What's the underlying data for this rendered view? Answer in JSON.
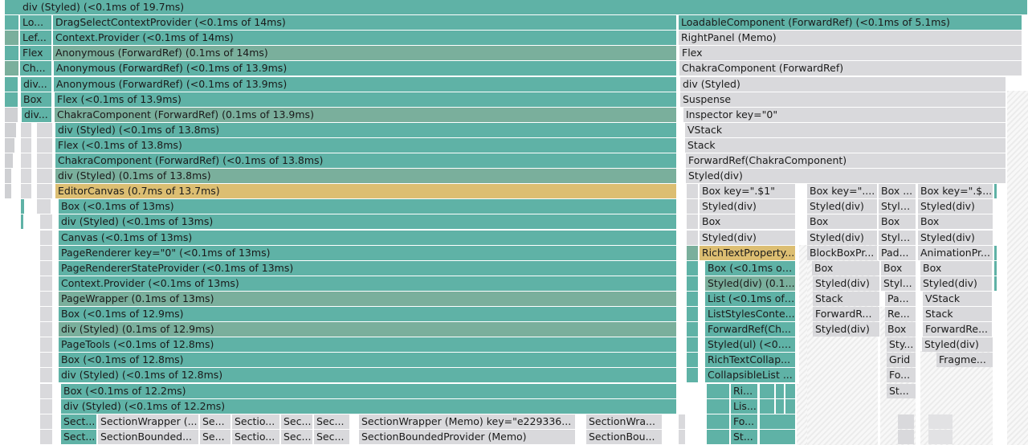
{
  "flamegraph": {
    "nodes": [
      {
        "label": "div (Styled) (<0.1ms of 19.7ms)",
        "c": "teal"
      },
      {
        "label": "Lo...",
        "c": "teal"
      },
      {
        "label": "DragSelectContextProvider (<0.1ms of 14ms)",
        "c": "teal"
      },
      {
        "label": "LoadableComponent (ForwardRef) (<0.1ms of 5.1ms)",
        "c": "teal"
      },
      {
        "label": "Lef...",
        "c": "teal"
      },
      {
        "label": "Context.Provider (<0.1ms of 14ms)",
        "c": "teal"
      },
      {
        "label": "RightPanel (Memo)",
        "c": "gray"
      },
      {
        "label": "Flex",
        "c": "teal"
      },
      {
        "label": "Anonymous (ForwardRef) (0.1ms of 14ms)",
        "c": "sage"
      },
      {
        "label": "Flex",
        "c": "gray"
      },
      {
        "label": "Ch...",
        "c": "teal"
      },
      {
        "label": "Anonymous (ForwardRef) (<0.1ms of 13.9ms)",
        "c": "teal"
      },
      {
        "label": "ChakraComponent (ForwardRef)",
        "c": "gray"
      },
      {
        "label": "div...",
        "c": "teal"
      },
      {
        "label": "Anonymous (ForwardRef) (<0.1ms of 13.9ms)",
        "c": "teal"
      },
      {
        "label": "div (Styled)",
        "c": "gray"
      },
      {
        "label": "Box",
        "c": "teal"
      },
      {
        "label": "Flex (<0.1ms of 13.9ms)",
        "c": "teal"
      },
      {
        "label": "Suspense",
        "c": "gray"
      },
      {
        "label": "div...",
        "c": "teal"
      },
      {
        "label": "ChakraComponent (ForwardRef) (0.1ms of 13.9ms)",
        "c": "sage"
      },
      {
        "label": "Inspector key=\"0\"",
        "c": "gray"
      },
      {
        "label": "div (Styled) (<0.1ms of 13.8ms)",
        "c": "teal"
      },
      {
        "label": "VStack",
        "c": "gray"
      },
      {
        "label": "Flex (<0.1ms of 13.8ms)",
        "c": "teal"
      },
      {
        "label": "Stack",
        "c": "gray"
      },
      {
        "label": "ChakraComponent (ForwardRef) (<0.1ms of 13.8ms)",
        "c": "teal"
      },
      {
        "label": "ForwardRef(ChakraComponent)",
        "c": "gray"
      },
      {
        "label": "div (Styled) (0.1ms of 13.8ms)",
        "c": "sage"
      },
      {
        "label": "Styled(div)",
        "c": "gray"
      },
      {
        "label": "EditorCanvas (0.7ms of 13.7ms)",
        "c": "gold"
      },
      {
        "label": "Box key=\".$1\"",
        "c": "gray"
      },
      {
        "label": "Box key=\"....",
        "c": "gray"
      },
      {
        "label": "Box ...",
        "c": "gray"
      },
      {
        "label": "Box key=\".$...",
        "c": "gray"
      },
      {
        "label": "Box (<0.1ms of 13ms)",
        "c": "teal"
      },
      {
        "label": "Styled(div)",
        "c": "gray"
      },
      {
        "label": "Styled(div)",
        "c": "gray"
      },
      {
        "label": "Style...",
        "c": "gray"
      },
      {
        "label": "Styled(div)",
        "c": "gray"
      },
      {
        "label": "div (Styled) (<0.1ms of 13ms)",
        "c": "teal"
      },
      {
        "label": "Box",
        "c": "gray"
      },
      {
        "label": "Box",
        "c": "gray"
      },
      {
        "label": "Box",
        "c": "gray"
      },
      {
        "label": "Box",
        "c": "gray"
      },
      {
        "label": "Canvas (<0.1ms of 13ms)",
        "c": "teal"
      },
      {
        "label": "Styled(div)",
        "c": "gray"
      },
      {
        "label": "Styled(div)",
        "c": "gray"
      },
      {
        "label": "Style...",
        "c": "gray"
      },
      {
        "label": "Styled(div)",
        "c": "gray"
      },
      {
        "label": "PageRenderer key=\"0\" (<0.1ms of 13ms)",
        "c": "teal"
      },
      {
        "label": "RichTextProperty...",
        "c": "gold"
      },
      {
        "label": "BlockBoxPr...",
        "c": "gray"
      },
      {
        "label": "Pad...",
        "c": "gray"
      },
      {
        "label": "AnimationPr...",
        "c": "gray"
      },
      {
        "label": "PageRendererStateProvider (<0.1ms of 13ms)",
        "c": "teal"
      },
      {
        "label": "Box (<0.1ms of ...",
        "c": "teal"
      },
      {
        "label": "Box",
        "c": "gray"
      },
      {
        "label": "Box",
        "c": "gray"
      },
      {
        "label": "Box",
        "c": "gray"
      },
      {
        "label": "Context.Provider (<0.1ms of 13ms)",
        "c": "teal"
      },
      {
        "label": "Styled(div) (0.1...",
        "c": "sage"
      },
      {
        "label": "Styled(div)",
        "c": "gray"
      },
      {
        "label": "Styl...",
        "c": "gray"
      },
      {
        "label": "Styled(div)",
        "c": "gray"
      },
      {
        "label": "PageWrapper (0.1ms of 13ms)",
        "c": "sage"
      },
      {
        "label": "List (<0.1ms of ...",
        "c": "teal"
      },
      {
        "label": "Stack",
        "c": "gray"
      },
      {
        "label": "Pa...",
        "c": "gray"
      },
      {
        "label": "VStack",
        "c": "gray"
      },
      {
        "label": "Box (<0.1ms of 12.9ms)",
        "c": "teal"
      },
      {
        "label": "ListStylesConte...",
        "c": "teal"
      },
      {
        "label": "ForwardR...",
        "c": "gray"
      },
      {
        "label": "Re...",
        "c": "gray"
      },
      {
        "label": "Stack",
        "c": "gray"
      },
      {
        "label": "div (Styled) (0.1ms of 12.9ms)",
        "c": "sage"
      },
      {
        "label": "ForwardRef(Ch...",
        "c": "teal"
      },
      {
        "label": "Styled(div)",
        "c": "gray"
      },
      {
        "label": "Box",
        "c": "gray"
      },
      {
        "label": "ForwardRe...",
        "c": "gray"
      },
      {
        "label": "PageTools (<0.1ms of 12.8ms)",
        "c": "teal"
      },
      {
        "label": "Styled(ul) (<0.1...",
        "c": "teal"
      },
      {
        "label": "Sty...",
        "c": "gray"
      },
      {
        "label": "Styled(div)",
        "c": "gray"
      },
      {
        "label": "Box (<0.1ms of 12.8ms)",
        "c": "teal"
      },
      {
        "label": "RichTextCollap...",
        "c": "teal"
      },
      {
        "label": "Grid",
        "c": "gray"
      },
      {
        "label": "Fragme...",
        "c": "gray"
      },
      {
        "label": "div (Styled) (<0.1ms of 12.8ms)",
        "c": "teal"
      },
      {
        "label": "CollapsibleList ...",
        "c": "teal"
      },
      {
        "label": "Fo...",
        "c": "gray"
      },
      {
        "label": "Box (<0.1ms of 12.2ms)",
        "c": "teal"
      },
      {
        "label": "Ri...",
        "c": "teal"
      },
      {
        "label": "St...",
        "c": "gray"
      },
      {
        "label": "div (Styled) (<0.1ms of 12.2ms)",
        "c": "teal"
      },
      {
        "label": "Lis...",
        "c": "teal"
      },
      {
        "label": "Sect...",
        "c": "teal"
      },
      {
        "label": "SectionWrapper (...",
        "c": "gray"
      },
      {
        "label": "Se...",
        "c": "gray"
      },
      {
        "label": "Sectio...",
        "c": "gray"
      },
      {
        "label": "Sec...",
        "c": "gray"
      },
      {
        "label": "Sec...",
        "c": "gray"
      },
      {
        "label": "SectionWrapper (Memo) key=\"e229336...",
        "c": "gray"
      },
      {
        "label": "SectionWra...",
        "c": "gray"
      },
      {
        "label": "Fo...",
        "c": "teal"
      },
      {
        "label": "Sect...",
        "c": "teal"
      },
      {
        "label": "SectionBounded...",
        "c": "gray"
      },
      {
        "label": "Se...",
        "c": "gray"
      },
      {
        "label": "Sectio...",
        "c": "gray"
      },
      {
        "label": "Sec...",
        "c": "gray"
      },
      {
        "label": "Sec...",
        "c": "gray"
      },
      {
        "label": "SectionBoundedProvider (Memo)",
        "c": "gray"
      },
      {
        "label": "SectionBou...",
        "c": "gray"
      },
      {
        "label": "St...",
        "c": "teal"
      }
    ]
  },
  "colors": {
    "teal": "#5fb2a6",
    "sage": "#7aaf9c",
    "gold": "#dcbe72",
    "gray": "#d9d9dc"
  }
}
